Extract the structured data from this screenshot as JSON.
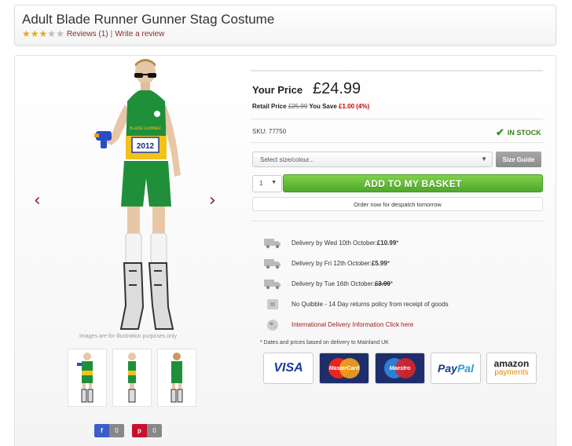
{
  "product": {
    "title": "Adult Blade Runner Gunner Stag Costume",
    "rating": {
      "filled": 3,
      "total": 5
    },
    "reviews_link": "Reviews (1)",
    "separator": "|",
    "write_review": "Write a review"
  },
  "gallery": {
    "prev_arrow": "‹",
    "next_arrow": "›",
    "note": "Images are for illustration purposes only",
    "shirt_text": "BLADE GUNNER",
    "shirt_number": "2012",
    "thumbnails": [
      "front",
      "side",
      "back"
    ]
  },
  "social": {
    "facebook": {
      "icon": "f",
      "count": "0"
    },
    "pinterest": {
      "icon": "p",
      "count": "0"
    }
  },
  "pricing": {
    "your_price_label": "Your Price",
    "price": "£24.99",
    "retail_label": "Retail Price",
    "retail_price": "£25.99",
    "save_label": "You Save",
    "save_amount": "£1.00 (4%)"
  },
  "stock": {
    "sku": "SKU: 77750",
    "status": "IN STOCK",
    "status_color": "#3a7d1c"
  },
  "purchase": {
    "size_placeholder": "Select size/colour...",
    "size_guide": "Size Guide",
    "quantity": "1",
    "add_to_basket": "ADD TO MY BASKET",
    "despatch_note": "Order now for despatch tomorrow",
    "button_color": "#5bb632"
  },
  "delivery": {
    "options": [
      {
        "text": "Delivery by Wed 10th October: ",
        "price": "£10.99",
        "suffix": " *",
        "struck": false
      },
      {
        "text": "Delivery by Fri 12th October: ",
        "price": "£5.99",
        "suffix": " *",
        "struck": false
      },
      {
        "text": "Delivery by Tue 16th October: ",
        "price": "£3.99",
        "suffix": " *",
        "struck": true
      }
    ],
    "returns": "No Quibble - 14 Day returns policy from receipt of goods",
    "international_link": "International Delivery Information Click here",
    "footnote": "* Dates and prices based on delivery to Mainland UK"
  },
  "payment": {
    "visa": "VISA",
    "mastercard": "MasterCard",
    "maestro": "Maestro",
    "paypal_pay": "Pay",
    "paypal_pal": "Pal",
    "amazon_1": "amazon",
    "amazon_2": "payments"
  }
}
